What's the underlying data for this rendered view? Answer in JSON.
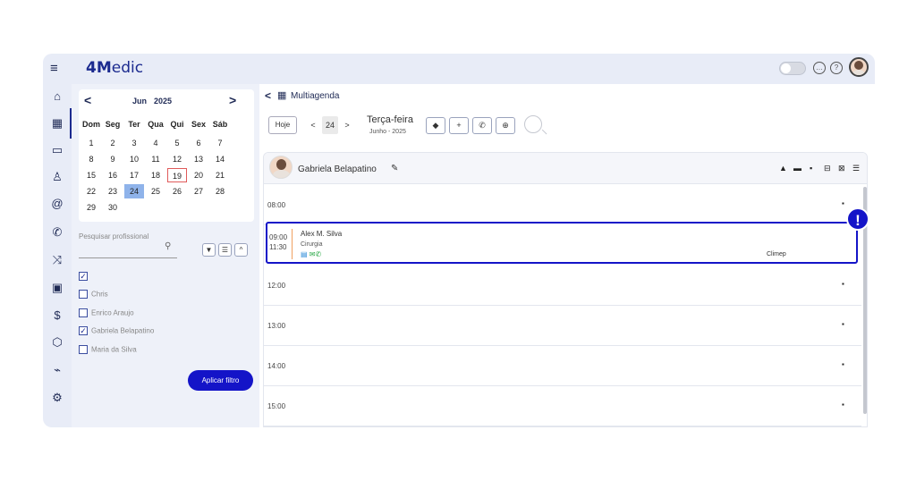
{
  "app": {
    "logo_prefix": "4M",
    "logo_rest": "edic",
    "hamburger": "≡"
  },
  "topbar": {
    "chat_icon": "speech-bubble-icon",
    "help_icon": "?"
  },
  "sidenav": {
    "items": [
      {
        "icon": "home-icon",
        "glyph": "⌂"
      },
      {
        "icon": "calendar-icon",
        "glyph": "▦"
      },
      {
        "icon": "inbox-icon",
        "glyph": "▭"
      },
      {
        "icon": "user-icon",
        "glyph": "♙"
      },
      {
        "icon": "at-icon",
        "glyph": "@"
      },
      {
        "icon": "phone-icon",
        "glyph": "✆"
      },
      {
        "icon": "shuffle-icon",
        "glyph": "⤨"
      },
      {
        "icon": "clipboard-icon",
        "glyph": "▣"
      },
      {
        "icon": "dollar-icon",
        "glyph": "$"
      },
      {
        "icon": "box-icon",
        "glyph": "⬡"
      },
      {
        "icon": "chart-icon",
        "glyph": "⌁"
      },
      {
        "icon": "settings-icon",
        "glyph": "⚙"
      }
    ]
  },
  "calendar": {
    "prev": "<",
    "next": ">",
    "month": "Jun",
    "year": "2025",
    "weekdays": [
      "Dom",
      "Seg",
      "Ter",
      "Qua",
      "Qui",
      "Sex",
      "Sáb"
    ],
    "weeks": [
      [
        "",
        "",
        "",
        "",
        "",
        "",
        ""
      ],
      [
        "1",
        "2",
        "3",
        "4",
        "5",
        "6",
        "7"
      ],
      [
        "8",
        "9",
        "10",
        "11",
        "12",
        "13",
        "14"
      ],
      [
        "15",
        "16",
        "17",
        "18",
        "19",
        "20",
        "21"
      ],
      [
        "22",
        "23",
        "24",
        "25",
        "26",
        "27",
        "28"
      ],
      [
        "29",
        "30",
        "",
        "",
        "",
        "",
        ""
      ]
    ],
    "today": "19",
    "selected": "24"
  },
  "filter": {
    "search_placeholder": "Pesquisar profissional",
    "filter_icon": "▼",
    "list_icon": "☰",
    "collapse_icon": "^",
    "professionals": [
      {
        "name": "",
        "checked": true
      },
      {
        "name": "Chris",
        "checked": false
      },
      {
        "name": "Enrico Araujo",
        "checked": false
      },
      {
        "name": "Gabriela Belapatino",
        "checked": true
      },
      {
        "name": "Maria da Silva",
        "checked": false
      }
    ],
    "apply_label": "Aplicar filtro"
  },
  "main": {
    "back": "<",
    "title": "Multiagenda",
    "today_label": "Hoje",
    "prev": "<",
    "day_number": "24",
    "next": ">",
    "day_name": "Terça-feira",
    "month_year": "Junho - 2025",
    "tools": [
      {
        "icon": "tag-icon",
        "glyph": "◆"
      },
      {
        "icon": "plus-icon",
        "glyph": "+"
      },
      {
        "icon": "whatsapp-icon",
        "glyph": "✆"
      },
      {
        "icon": "globe-icon",
        "glyph": "⊕"
      }
    ]
  },
  "schedule": {
    "professional": "Gabriela Belapatino",
    "header_icons": [
      "▲",
      "▬",
      "🔒",
      "⊟",
      "⊠",
      "☰"
    ],
    "slots": [
      {
        "time": "08:00"
      },
      {
        "time": "12:00"
      },
      {
        "time": "13:00"
      },
      {
        "time": "14:00"
      },
      {
        "time": "15:00"
      }
    ],
    "appointment": {
      "start": "09:00",
      "end": "11:30",
      "patient": "Alex M. Silva",
      "procedure": "Cirurgia",
      "place": "Climep",
      "icons": [
        "clipboard-icon",
        "email-icon",
        "whatsapp-icon"
      ]
    },
    "alert": "!"
  },
  "colors": {
    "accent": "#1414c8",
    "brand": "#1b2a8f",
    "selected_day": "#8fb3ea",
    "today_border": "#e05a5a"
  }
}
